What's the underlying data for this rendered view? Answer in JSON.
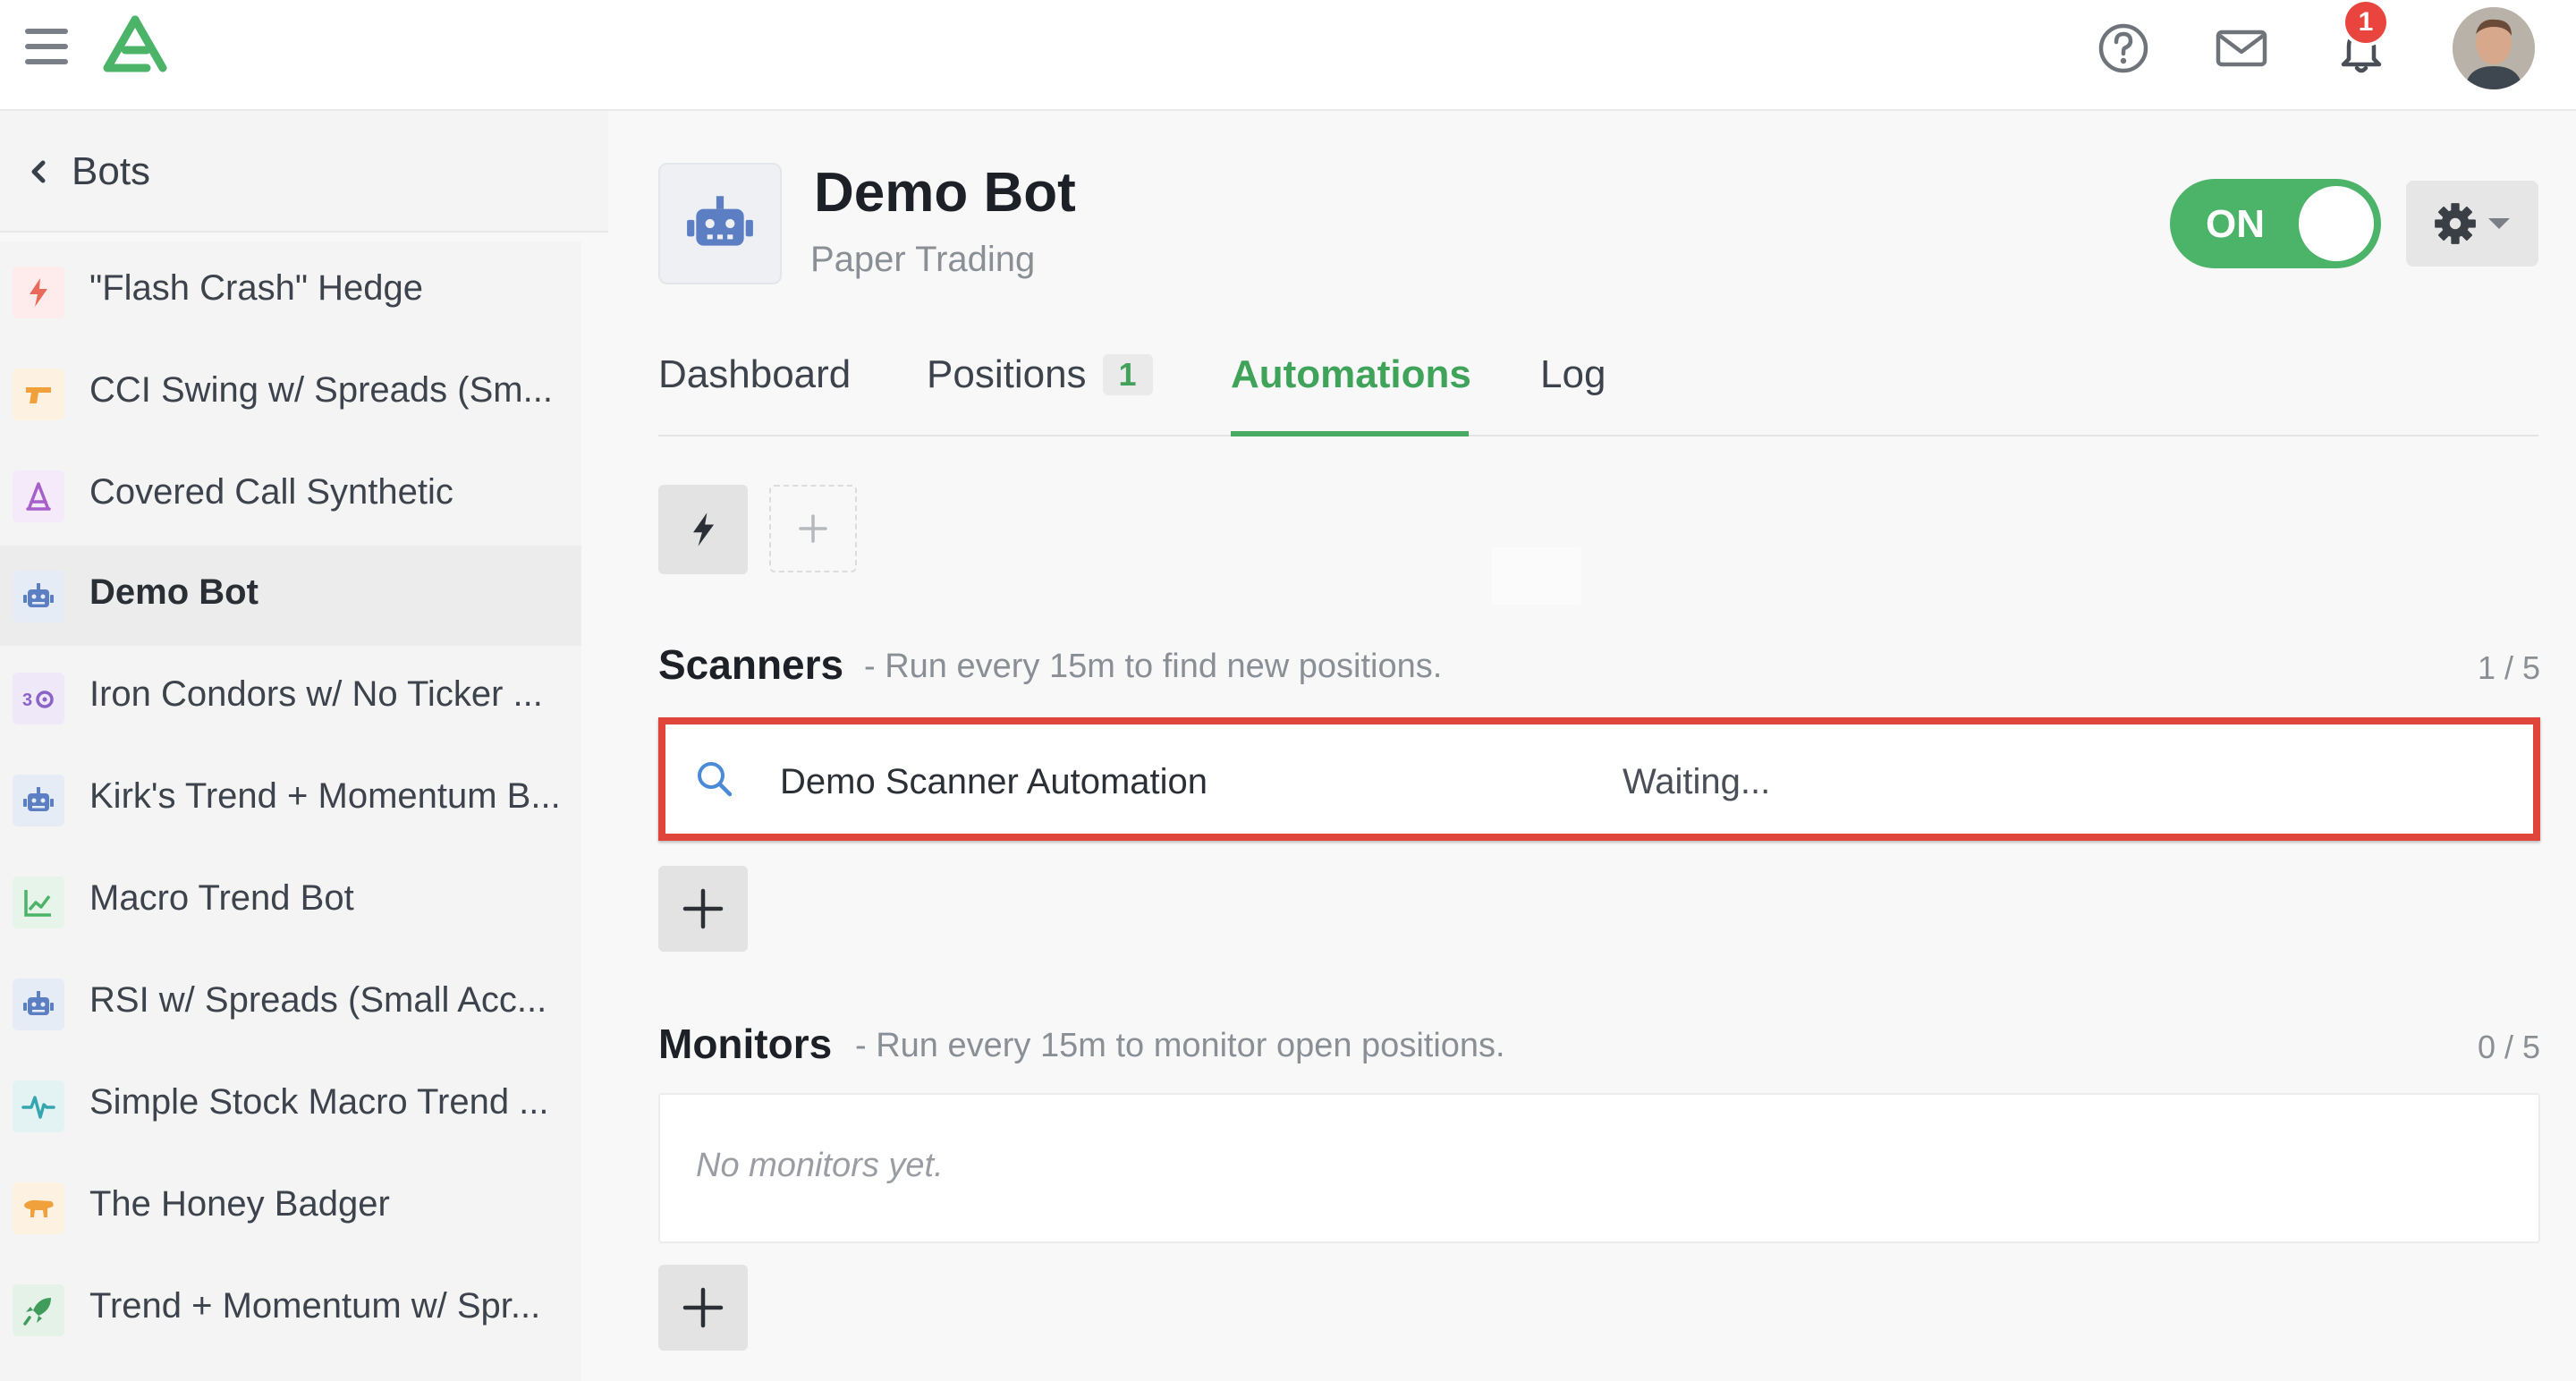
{
  "topbar": {
    "notifications_count": "1",
    "icons": [
      "menu-icon",
      "logo-icon",
      "help-icon",
      "mail-icon",
      "bell-icon",
      "avatar"
    ]
  },
  "sidebar": {
    "back_label": "Bots",
    "items": [
      {
        "label": "\"Flash Crash\" Hedge",
        "icon": "lightning-icon",
        "color": "#e86a5a",
        "bg": "#fdeceb"
      },
      {
        "label": "CCI Swing w/ Spreads (Sm...",
        "icon": "gun-icon",
        "color": "#f1a13b",
        "bg": "#fdf1e2"
      },
      {
        "label": "Covered Call Synthetic",
        "icon": "pen-compass-icon",
        "color": "#a760c9",
        "bg": "#f4eafa"
      },
      {
        "label": "Demo Bot",
        "icon": "robot-icon",
        "color": "#5b7fc2",
        "bg": "#e6ecf6",
        "active": true
      },
      {
        "label": "Iron Condors w/ No Ticker ...",
        "icon": "condor-icon",
        "color": "#8a63c6",
        "bg": "#efe8f8"
      },
      {
        "label": "Kirk's Trend + Momentum B...",
        "icon": "robot-icon",
        "color": "#5b7fc2",
        "bg": "#e6ecf6"
      },
      {
        "label": "Macro Trend Bot",
        "icon": "chart-line-icon",
        "color": "#4cb468",
        "bg": "#e6f4ea"
      },
      {
        "label": "RSI w/ Spreads (Small Acc...",
        "icon": "robot-icon",
        "color": "#5b7fc2",
        "bg": "#e6ecf6"
      },
      {
        "label": "Simple Stock Macro Trend ...",
        "icon": "pulse-icon",
        "color": "#35a6b0",
        "bg": "#e3f3f4"
      },
      {
        "label": "The Honey Badger",
        "icon": "badger-icon",
        "color": "#f1a13b",
        "bg": "#fdf1e2"
      },
      {
        "label": "Trend + Momentum w/ Spr...",
        "icon": "rocket-icon",
        "color": "#3f9c5b",
        "bg": "#e4f2e8"
      }
    ]
  },
  "bot": {
    "title": "Demo Bot",
    "subtitle": "Paper Trading",
    "toggle_label": "ON",
    "accent_color": "#4cb468"
  },
  "tabs": [
    {
      "label": "Dashboard"
    },
    {
      "label": "Positions",
      "badge": "1"
    },
    {
      "label": "Automations",
      "active": true
    },
    {
      "label": "Log"
    }
  ],
  "scanners": {
    "title": "Scanners",
    "description": "- Run every 15m to find new positions.",
    "count": "1 / 5",
    "items": [
      {
        "name": "Demo Scanner Automation",
        "status": "Waiting..."
      }
    ]
  },
  "monitors": {
    "title": "Monitors",
    "description": "- Run every 15m to monitor open positions.",
    "count": "0 / 5",
    "empty_text": "No monitors yet."
  },
  "highlight_color": "#e0453b"
}
